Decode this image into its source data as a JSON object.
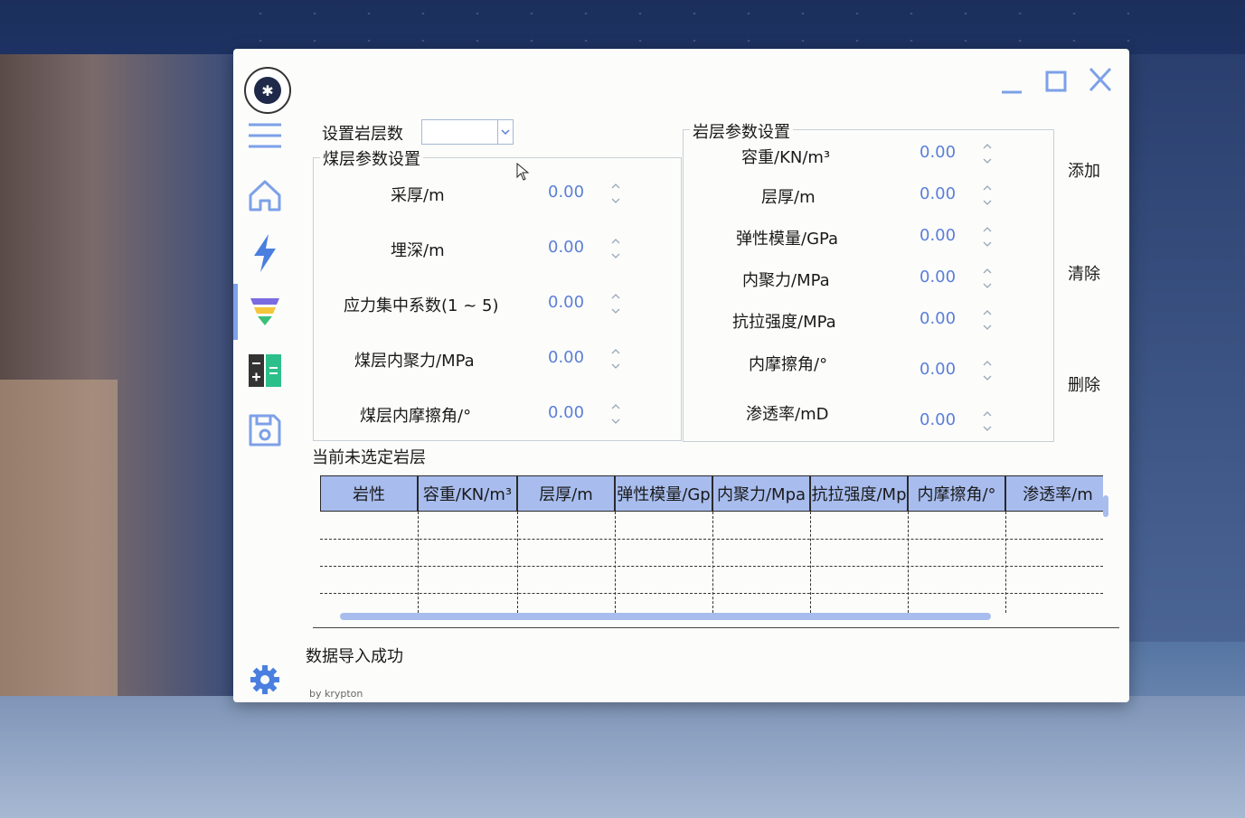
{
  "window": {
    "minimize_label": "minimize",
    "maximize_label": "maximize",
    "close_label": "close"
  },
  "nav": {
    "items": [
      "menu",
      "home",
      "flash",
      "filter",
      "calculator",
      "save",
      "settings"
    ]
  },
  "layer_count": {
    "label": "设置岩层数",
    "value": ""
  },
  "coal_group": {
    "title": "煤层参数设置",
    "fields": [
      {
        "label": "采厚/m",
        "value": "0.00"
      },
      {
        "label": "埋深/m",
        "value": "0.00"
      },
      {
        "label": "应力集中系数(1 ~ 5)",
        "value": "0.00"
      },
      {
        "label": "煤层内聚力/MPa",
        "value": "0.00"
      },
      {
        "label": "煤层内摩擦角/°",
        "value": "0.00"
      }
    ]
  },
  "rock_group": {
    "title": "岩层参数设置",
    "fields": [
      {
        "label": "容重/KN/m³",
        "value": "0.00"
      },
      {
        "label": "层厚/m",
        "value": "0.00"
      },
      {
        "label": "弹性模量/GPa",
        "value": "0.00"
      },
      {
        "label": "内聚力/MPa",
        "value": "0.00"
      },
      {
        "label": "抗拉强度/MPa",
        "value": "0.00"
      },
      {
        "label": "内摩擦角/°",
        "value": "0.00"
      },
      {
        "label": "渗透率/mD",
        "value": "0.00"
      }
    ]
  },
  "actions": {
    "add": "添加",
    "clear": "清除",
    "delete": "删除"
  },
  "table": {
    "caption": "当前未选定岩层",
    "columns": [
      "岩性",
      "容重/KN/m³",
      "层厚/m",
      "弹性模量/Gp",
      "内聚力/Mpa",
      "抗拉强度/Mp",
      "内摩擦角/°",
      "渗透率/m"
    ]
  },
  "status": "数据导入成功",
  "credit": "by krypton",
  "colors": {
    "accent": "#7da0e8",
    "header_bg": "#a8bdee",
    "value_text": "#5b7ed9"
  }
}
